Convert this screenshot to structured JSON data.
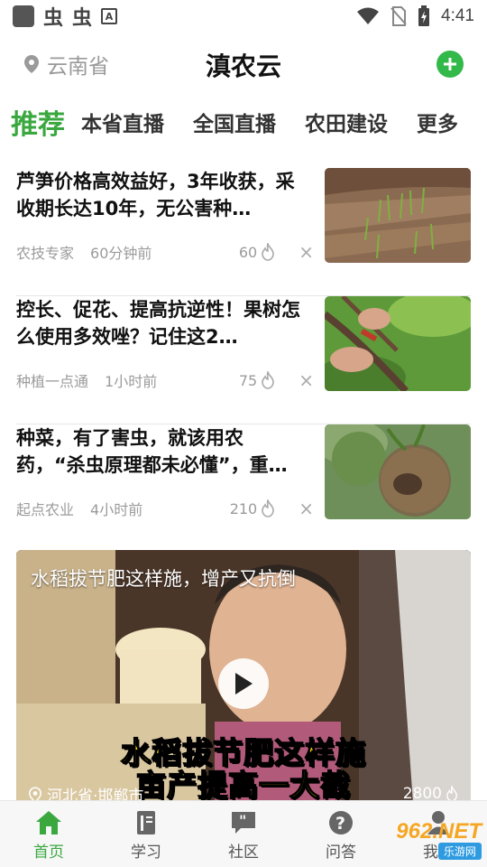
{
  "status_bar": {
    "time": "4:41",
    "bug_glyph": "虫"
  },
  "header": {
    "location": "云南省",
    "title": "滇农云"
  },
  "tabs": [
    {
      "label": "推荐",
      "active": true
    },
    {
      "label": "本省直播"
    },
    {
      "label": "全国直播"
    },
    {
      "label": "农田建设"
    },
    {
      "label": "更多"
    }
  ],
  "articles": [
    {
      "title": "芦笋价格高效益好，3年收获，采收期长达10年，无公害种…",
      "source": "农技专家",
      "time": "60分钟前",
      "count": "60"
    },
    {
      "title": "控长、促花、提高抗逆性！果树怎么使用多效唑？记住这2…",
      "source": "种植一点通",
      "time": "1小时前",
      "count": "75"
    },
    {
      "title": "种菜，有了害虫，就该用农药，“杀虫原理都未必懂”，重…",
      "source": "起点农业",
      "time": "4小时前",
      "count": "210"
    }
  ],
  "video": {
    "title": "水稻拔节肥这样施，增产又抗倒",
    "caption_line1": "水稻拔节肥这样施",
    "caption_line2": "亩产提高一大截",
    "location": "河北省·邯郸市",
    "count": "2800"
  },
  "bottom_nav": [
    {
      "label": "首页",
      "icon": "home-icon",
      "active": true
    },
    {
      "label": "学习",
      "icon": "book-icon"
    },
    {
      "label": "社区",
      "icon": "chat-icon"
    },
    {
      "label": "问答",
      "icon": "question-icon"
    },
    {
      "label": "我的",
      "icon": "user-icon"
    }
  ],
  "watermark": {
    "top": "962.NET",
    "bottom": "乐游网"
  },
  "colors": {
    "accent": "#3aa83f",
    "add_button": "#33b84a",
    "caption": "#ffe600"
  }
}
